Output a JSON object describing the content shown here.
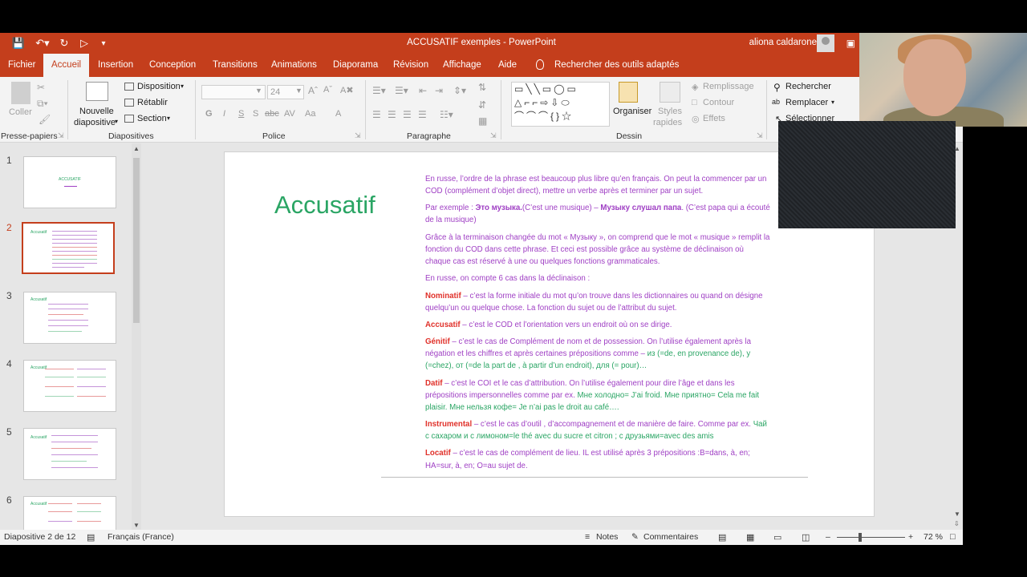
{
  "window": {
    "title": "ACCUSATIF exemples  -  PowerPoint",
    "user": "aliona caldarone"
  },
  "tabs": [
    "Fichier",
    "Accueil",
    "Insertion",
    "Conception",
    "Transitions",
    "Animations",
    "Diaporama",
    "Révision",
    "Affichage",
    "Aide"
  ],
  "tell_me": "Rechercher des outils adaptés",
  "ribbon": {
    "clipboard": {
      "paste": "Coller",
      "label": "Presse-papiers"
    },
    "slides": {
      "new_slide_1": "Nouvelle",
      "new_slide_2": "diapositive",
      "layout": "Disposition",
      "reset": "Rétablir",
      "section": "Section",
      "label": "Diapositives"
    },
    "font": {
      "size": "24",
      "bold": "G",
      "italic": "I",
      "underline": "S",
      "shadow": "S",
      "strike": "abc",
      "spacing": "AV",
      "case": "Aa",
      "color": "A",
      "label": "Police"
    },
    "paragraph": {
      "label": "Paragraphe"
    },
    "drawing": {
      "arrange": "Organiser",
      "styles_1": "Styles",
      "styles_2": "rapides",
      "fill": "Remplissage",
      "outline": "Contour",
      "effects": "Effets",
      "label": "Dessin"
    },
    "editing": {
      "find": "Rechercher",
      "replace": "Remplacer",
      "select": "Sélectionner"
    }
  },
  "thumbnails": [
    {
      "num": "1"
    },
    {
      "num": "2"
    },
    {
      "num": "3"
    },
    {
      "num": "4"
    },
    {
      "num": "5"
    },
    {
      "num": "6"
    }
  ],
  "slide": {
    "title": "Accusatif",
    "p1": "En russe, l’ordre de la phrase est beaucoup plus libre qu’en français. On peut la commencer par un COD (complément d’objet direct),  mettre un verbe après  et terminer par un sujet.",
    "p2_a": "Par exemple : ",
    "p2_b": "Это музыка.",
    "p2_c": "(C’est une musique) – ",
    "p2_d": "Музыку слушал папа",
    "p2_e": ".  (C’est papa qui a écouté de la musique)",
    "p3": "Grâce à la terminaison changée du mot « Музыку », on comprend que le mot « musique » remplit la fonction du COD dans cette phrase. Et ceci est possible grâce au système de déclinaison où chaque cas est réservé à une ou quelques fonctions grammaticales.",
    "p4": "En russe, on compte 6 cas dans la déclinaison :",
    "nom_h": "Nominatif",
    "nom_t": " – c’est la forme initiale du mot qu’on trouve dans les dictionnaires ou quand on désigne quelqu’un ou quelque chose.  La fonction du sujet ou de l’attribut du sujet.",
    "acc_h": "Accusatif",
    "acc_t": " – c’est le COD et l’orientation vers un endroit où on se dirige.",
    "gen_h": "Génitif",
    "gen_t": " – c’est le cas de Complément de nom et de possession. On l’utilise également après la négation et les chiffres et après certaines prépositions comme – ",
    "gen_g": "из (=de, en provenance de), у (=chez), от (=de la part de , à partir d’un endroit), для (= pour)…",
    "dat_h": "Datif",
    "dat_t": " – c’est le COI  et le cas d’attribution. On l’utilise également pour dire l’âge et dans les prépositions impersonnelles comme par ex. ",
    "dat_g": "Мне холодно= J’ai froid. Мне приятно= Cela me fait plaisir. Мне нельзя кофе= Je n’ai pas le droit au café….",
    "ins_h": "Instrumental",
    "ins_t": " – c’est le cas d’outil , d’accompagnement et de manière de faire. Comme par ex. ",
    "ins_g": "Чай с сахаром и с лимоном=le thé avec du sucre et citron ;   с друзьями=avec des amis",
    "loc_h": "Locatif",
    "loc_t": " – c’est le cas de complément de lieu. IL est utilisé après 3 prépositions :В=dans, à, en; НА=sur, à, en; О=au sujet de."
  },
  "status": {
    "slide_of": "Diapositive 2 de 12",
    "language": "Français (France)",
    "notes": "Notes",
    "comments": "Commentaires",
    "zoom": "72 %"
  },
  "colors": {
    "accent": "#c43e1c",
    "title_green": "#2aa564",
    "body_purple": "#9f3fc4",
    "case_red": "#e0312a"
  }
}
